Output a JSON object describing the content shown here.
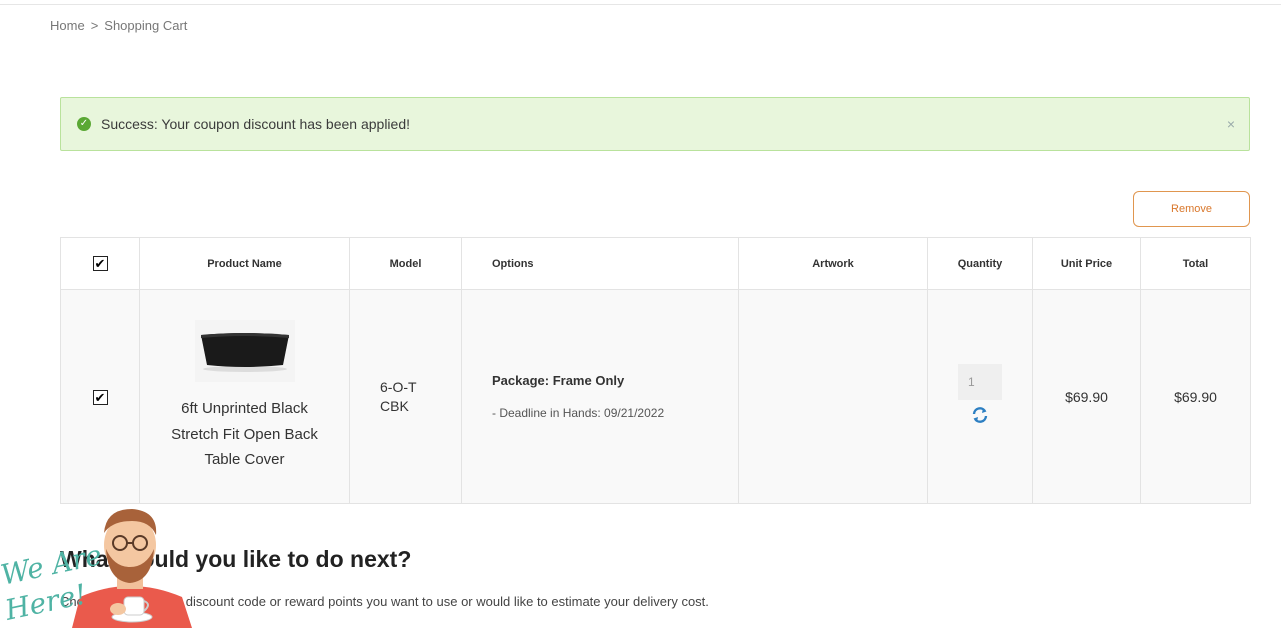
{
  "breadcrumb": {
    "home": "Home",
    "sep": ">",
    "current": "Shopping Cart"
  },
  "alert": {
    "message": "Success: Your coupon discount has been applied!",
    "close": "×"
  },
  "actions": {
    "remove": "Remove"
  },
  "table": {
    "headers": {
      "product": "Product Name",
      "model": "Model",
      "options": "Options",
      "artwork": "Artwork",
      "quantity": "Quantity",
      "unit_price": "Unit Price",
      "total": "Total"
    },
    "rows": [
      {
        "checked": true,
        "product_name": "6ft Unprinted Black Stretch Fit Open Back Table Cover",
        "model": "6-O-TCBK",
        "option_package": "Package: Frame Only",
        "option_deadline": "- Deadline in Hands: 09/21/2022",
        "artwork": "",
        "quantity": "1",
        "unit_price": "$69.90",
        "total": "$69.90"
      }
    ]
  },
  "next": {
    "heading": "What would you like to do next?",
    "description": "Choose if you have a discount code or reward points you want to use or would like to estimate your delivery cost."
  },
  "mascot": {
    "text_line1": "We Are",
    "text_line2": "Here!"
  },
  "colors": {
    "accent": "#d9772b",
    "success_bg": "#e8f6dc",
    "link_blue": "#2d7fc2"
  }
}
